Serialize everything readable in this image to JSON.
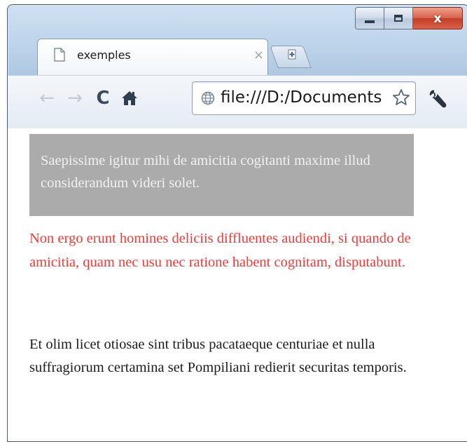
{
  "window": {
    "controls": {
      "minimize_icon": "minimize-icon",
      "maximize_icon": "maximize-icon",
      "close_label": "x"
    }
  },
  "tab": {
    "title": "exemples",
    "close": "×",
    "icon": "page-icon"
  },
  "newtab": {
    "icon": "new-tab-icon"
  },
  "toolbar": {
    "back": "←",
    "forward": "→",
    "reload": "C",
    "home_icon": "home-icon",
    "url": "file:///D:/Documents",
    "star_icon": "star-icon",
    "wrench_icon": "wrench-icon"
  },
  "content": {
    "grey_para": "Saepissime igitur mihi de amicitia cogitanti maxime illud considerandum videri solet.",
    "red_para": "Non ergo erunt homines deliciis diffluentes audiendi, si quando de amicitia, quam nec usu nec ratione habent cognitam, disputabunt.",
    "black_para": "Et olim licet otiosae sint tribus pacataeque centuriae et nulla suffragiorum certamina set Pompiliani redierit securitas temporis."
  },
  "colors": {
    "grey_block": "#ababab",
    "red_text": "#f13a3a",
    "body_text": "#1c1c1c"
  }
}
